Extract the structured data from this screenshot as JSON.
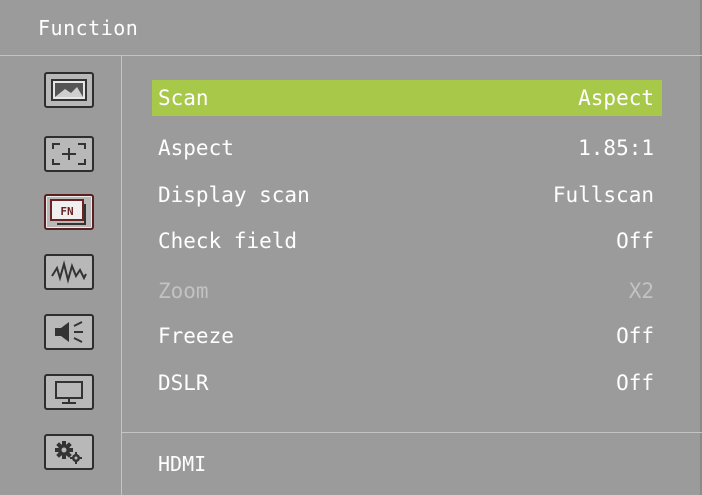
{
  "header": {
    "title": "Function"
  },
  "sidebar": {
    "icons": [
      "picture-icon",
      "marker-icon",
      "function-icon",
      "waveform-icon",
      "audio-icon",
      "display-icon",
      "settings-icon"
    ],
    "fn_glyph": "FN",
    "active_index": 2
  },
  "menu": {
    "items": [
      {
        "label": "Scan",
        "value": "Aspect",
        "state": "selected"
      },
      {
        "label": "Aspect",
        "value": "1.85:1",
        "state": "normal"
      },
      {
        "label": "Display scan",
        "value": "Fullscan",
        "state": "normal"
      },
      {
        "label": "Check field",
        "value": "Off",
        "state": "normal"
      },
      {
        "label": "Zoom",
        "value": "X2",
        "state": "disabled"
      },
      {
        "label": "Freeze",
        "value": "Off",
        "state": "normal"
      },
      {
        "label": "DSLR",
        "value": "Off",
        "state": "normal"
      }
    ]
  },
  "footer": {
    "source": "HDMI"
  },
  "colors": {
    "background": "#9b9b9b",
    "highlight": "#a8c84a",
    "text": "#ffffff",
    "disabled_text": "#c2c2c2"
  }
}
